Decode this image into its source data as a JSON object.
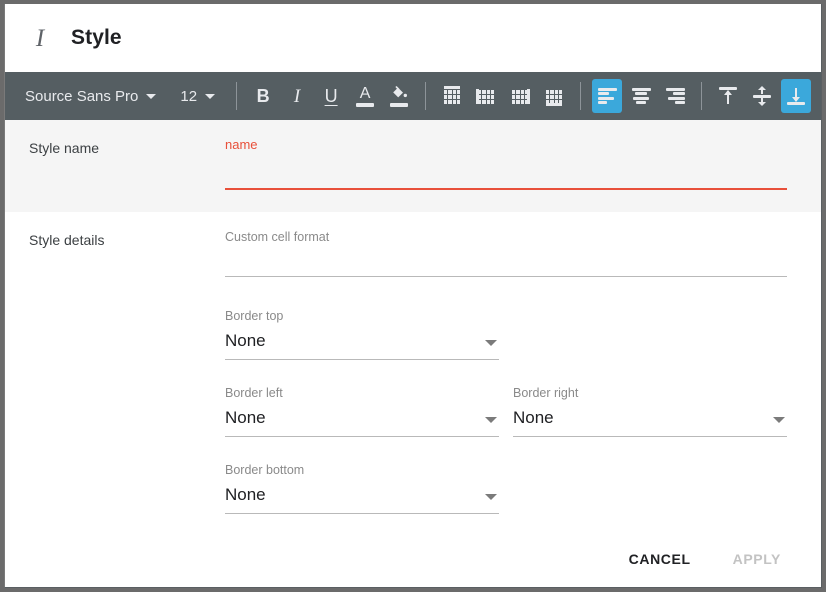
{
  "window": {
    "title": "Style",
    "title_icon": "italic-style-icon"
  },
  "toolbar": {
    "font_family": "Source Sans Pro",
    "font_size": "12",
    "buttons": [
      {
        "name": "bold",
        "label": "B"
      },
      {
        "name": "italic",
        "label": "I"
      },
      {
        "name": "underline",
        "label": "U"
      },
      {
        "name": "text-color",
        "label": "A"
      },
      {
        "name": "fill-color",
        "label": "fill"
      }
    ],
    "border_buttons": [
      "Border top",
      "Border left",
      "Border right",
      "Border bottom"
    ],
    "align_buttons": [
      "Align left",
      "Align center",
      "Align right"
    ],
    "valign_buttons": [
      "Align top",
      "Align middle",
      "Align bottom"
    ],
    "active_align": "Align left",
    "active_valign": "Align bottom",
    "accent_color": "#3ba8db",
    "bar_color": "#555e62"
  },
  "style_name_section": {
    "label": "Style name",
    "field": {
      "label": "name",
      "value": "",
      "error": true,
      "error_color": "#e8503a"
    }
  },
  "style_details_section": {
    "label": "Style details",
    "custom_cell_format": {
      "label": "Custom cell format",
      "value": ""
    },
    "selects": [
      {
        "label": "Border top",
        "value": "None"
      },
      {
        "label": "Border left",
        "value": "None"
      },
      {
        "label": "Border right",
        "value": "None"
      },
      {
        "label": "Border bottom",
        "value": "None"
      }
    ]
  },
  "footer": {
    "cancel_label": "CANCEL",
    "apply_label": "APPLY",
    "apply_disabled": true
  }
}
